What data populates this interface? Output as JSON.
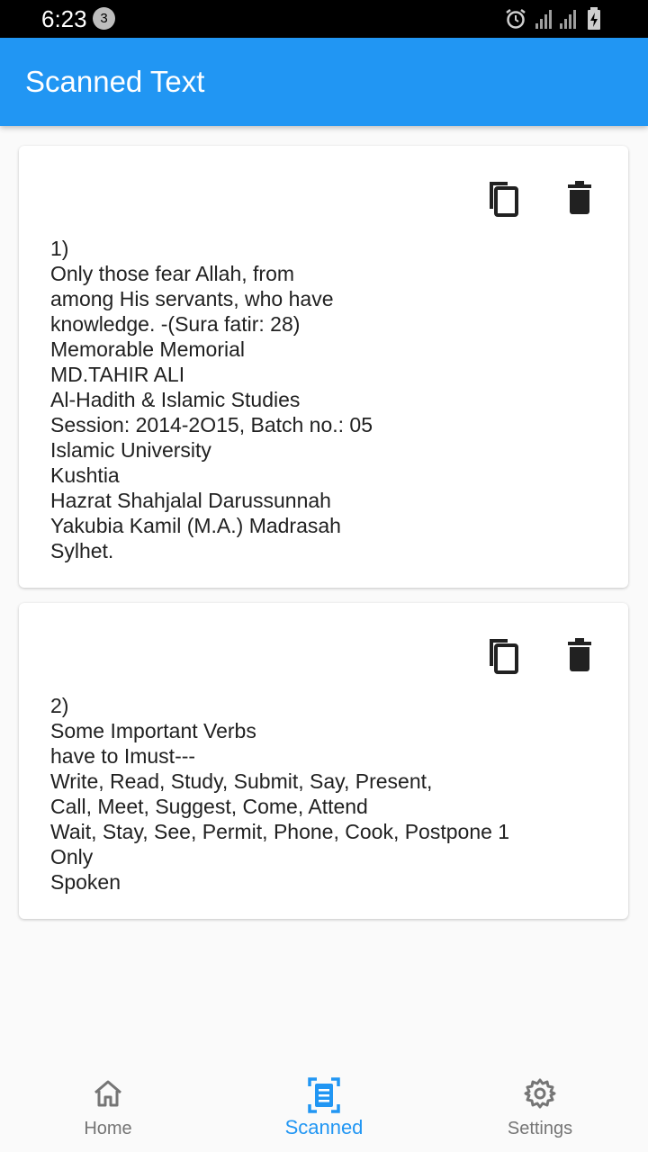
{
  "status_bar": {
    "time": "6:23",
    "notification_count": "3",
    "icons": [
      "alarm-icon",
      "signal-icon",
      "signal-icon",
      "battery-charging-icon"
    ]
  },
  "app_bar": {
    "title": "Scanned Text"
  },
  "cards": [
    {
      "index_label": "1)",
      "text": "Only those fear Allah, from\namong His servants, who have\nknowledge. -(Sura fatir: 28)\nMemorable Memorial\nMD.TAHIR ALI\nAl-Hadith & Islamic Studies\nSession: 2014-2O15, Batch no.: 05\nIslamic University\nKushtia\nHazrat Shahjalal Darussunnah\nYakubia Kamil (M.A.) Madrasah\nSylhet.",
      "actions": [
        "copy-icon",
        "delete-icon"
      ]
    },
    {
      "index_label": "2)",
      "text": "Some Important Verbs\nhave to Imust---\nWrite, Read, Study, Submit, Say, Present,\nCall, Meet, Suggest, Come, Attend\nWait, Stay, See, Permit, Phone, Cook, Postpone 1\nOnly\nSpoken",
      "actions": [
        "copy-icon",
        "delete-icon"
      ]
    }
  ],
  "bottom_nav": {
    "items": [
      {
        "label": "Home",
        "icon": "home-icon",
        "active": false
      },
      {
        "label": "Scanned",
        "icon": "document-scan-icon",
        "active": true
      },
      {
        "label": "Settings",
        "icon": "gear-icon",
        "active": false
      }
    ]
  },
  "colors": {
    "primary": "#2196f3",
    "inactive": "#757575",
    "text": "#212121"
  }
}
